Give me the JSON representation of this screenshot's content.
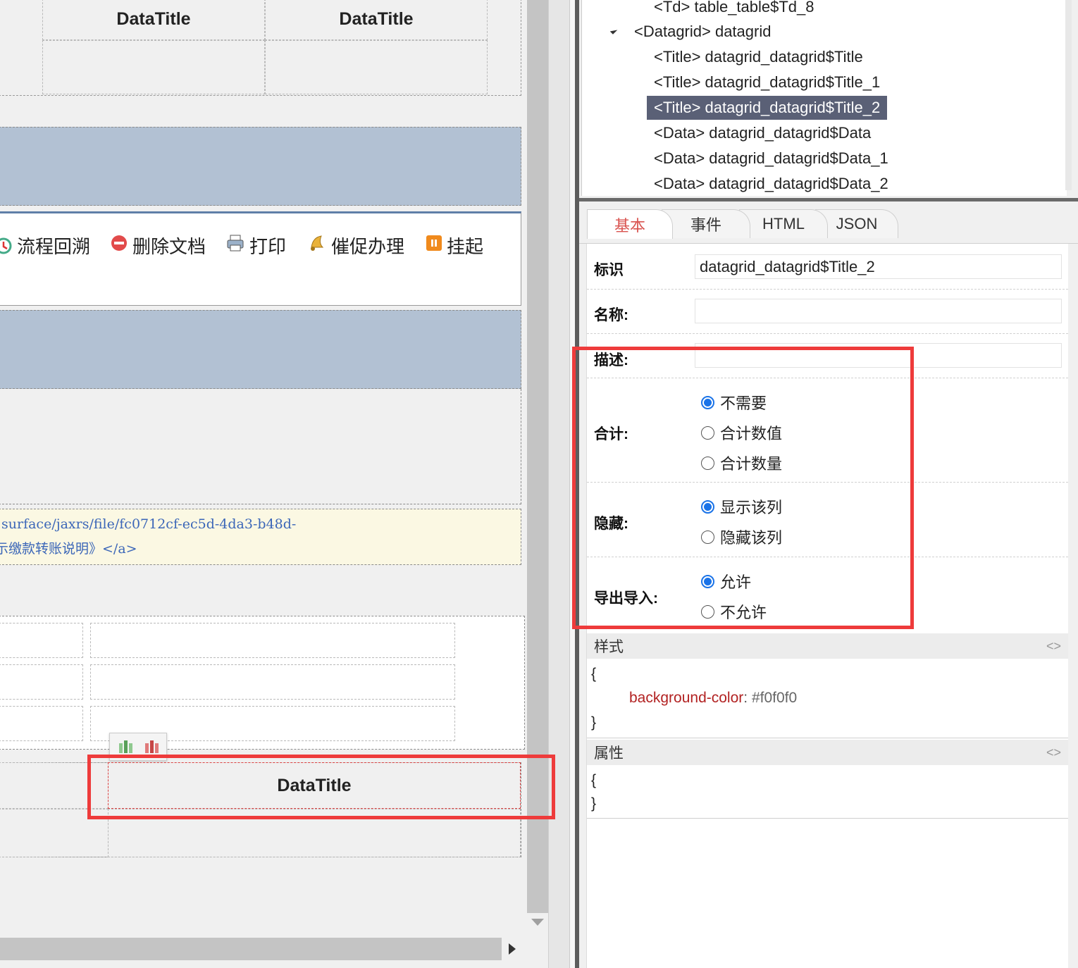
{
  "canvas": {
    "top_table": {
      "headers": [
        "DataTitle",
        "DataTitle"
      ]
    },
    "toolbar": [
      {
        "icon": "trace-back-icon",
        "label": "流程回溯"
      },
      {
        "icon": "delete-document-icon",
        "label": "删除文档"
      },
      {
        "icon": "print-icon",
        "label": "打印"
      },
      {
        "icon": "urge-icon",
        "label": "催促办理"
      },
      {
        "icon": "suspend-icon",
        "label": "挂起"
      }
    ],
    "code_block": {
      "line1": "surface/jaxrs/file/fc0712cf-ec5d-4da3-b48d-",
      "line2": "示缴款转账说明》</a>"
    },
    "selected_title": "DataTitle"
  },
  "tree": {
    "items": [
      {
        "tag": "<Td>",
        "name": "table_table$Td_8"
      },
      {
        "tag": "<Datagrid>",
        "name": "datagrid"
      },
      {
        "tag": "<Title>",
        "name": "datagrid_datagrid$Title"
      },
      {
        "tag": "<Title>",
        "name": "datagrid_datagrid$Title_1"
      },
      {
        "tag": "<Title>",
        "name": "datagrid_datagrid$Title_2"
      },
      {
        "tag": "<Data>",
        "name": "datagrid_datagrid$Data"
      },
      {
        "tag": "<Data>",
        "name": "datagrid_datagrid$Data_1"
      },
      {
        "tag": "<Data>",
        "name": "datagrid_datagrid$Data_2"
      }
    ],
    "labels": [
      "<Td> table_table$Td_8",
      "<Datagrid> datagrid",
      "<Title> datagrid_datagrid$Title",
      "<Title> datagrid_datagrid$Title_1",
      "<Title> datagrid_datagrid$Title_2",
      "<Data> datagrid_datagrid$Data",
      "<Data> datagrid_datagrid$Data_1",
      "<Data> datagrid_datagrid$Data_2"
    ]
  },
  "tabs": [
    "基本",
    "事件",
    "HTML",
    "JSON"
  ],
  "props": {
    "id_label": "标识",
    "id_value": "datagrid_datagrid$Title_2",
    "name_label": "名称:",
    "name_value": "",
    "desc_label": "描述:",
    "desc_value": "",
    "total_label": "合计:",
    "total_options": [
      "不需要",
      "合计数值",
      "合计数量"
    ],
    "hide_label": "隐藏:",
    "hide_options": [
      "显示该列",
      "隐藏该列"
    ],
    "export_label": "导出导入:",
    "export_options": [
      "允许",
      "不允许"
    ]
  },
  "style_section": {
    "title": "样式",
    "open": "{",
    "prop": "background-color",
    "colon": ":",
    "value": "#f0f0f0",
    "close": "}"
  },
  "attr_section": {
    "title": "属性",
    "open": "{",
    "close": "}"
  },
  "colors": {
    "highlight_box": "#ee3b3b",
    "tree_selected": "#5a6076",
    "active_tab": "#d9534f",
    "radio_on": "#1a73e8"
  }
}
